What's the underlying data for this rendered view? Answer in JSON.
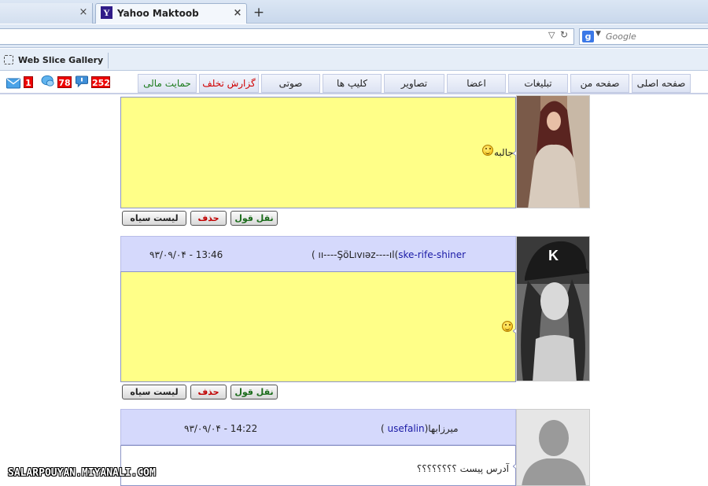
{
  "browser": {
    "tabs": [
      {
        "title": "",
        "close": "×"
      },
      {
        "title": "Yahoo Maktoob",
        "icon": "Y",
        "close": "×"
      }
    ],
    "new_tab": "+",
    "search": {
      "engine_icon": "g",
      "placeholder": "Google"
    },
    "favorites": {
      "web_slice": "Web Slice Gallery"
    }
  },
  "site_nav": {
    "badges": {
      "mail": "1",
      "chat": "78",
      "comments": "252"
    },
    "tabs": [
      "صفحه اصلی",
      "صفحه من",
      "تبلیغات",
      "اعضا",
      "تصاویر",
      "کلیپ ها",
      "صوتی",
      "گزارش تخلف",
      "حمایت مالی"
    ],
    "colors": {
      "report": "#d00000",
      "donate": "#1a7a1a"
    }
  },
  "posts": [
    {
      "text": "جالبه",
      "has_header": false,
      "actions": {
        "quote": "نقل قول",
        "delete": "حذف",
        "blacklist": "لیست سیاه"
      }
    },
    {
      "date": "۹۳/۰۹/۰۴ - 13:46",
      "author_prefix": "( ",
      "author_name": "ıı----ŞöLıvıəz----ıl(",
      "author_link": "ske-rife-shiner",
      "text": "",
      "has_header": true,
      "actions": {
        "quote": "نقل قول",
        "delete": "حذف",
        "blacklist": "لیست سیاه"
      }
    },
    {
      "date": "۹۳/۰۹/۰۴ - 14:22",
      "author_prefix": "( ",
      "author_link": "usefalin",
      "author_name": "میرزابها(",
      "text": "آدرس پیست ؟؟؟؟؟؟؟؟",
      "has_header": true
    }
  ],
  "watermark": "SALARPOUYAN.MIYANALI.COM"
}
